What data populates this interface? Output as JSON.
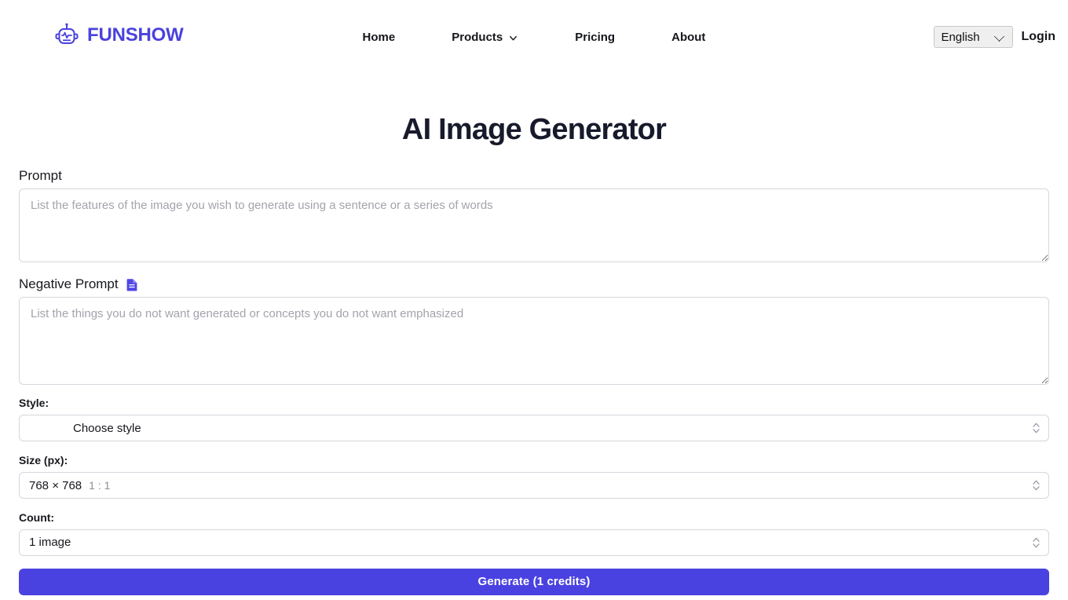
{
  "header": {
    "brand": {
      "name": "FUNSHOW",
      "icon": "robot-icon",
      "color": "#4a42dd"
    },
    "nav": [
      {
        "label": "Home",
        "has_chevron": false
      },
      {
        "label": "Products",
        "has_chevron": true
      },
      {
        "label": "Pricing",
        "has_chevron": false
      },
      {
        "label": "About",
        "has_chevron": false
      }
    ],
    "language": {
      "selected": "English",
      "options": [
        "English"
      ]
    },
    "login_label": "Login"
  },
  "page": {
    "title": "AI Image Generator"
  },
  "form": {
    "prompt": {
      "label": "Prompt",
      "value": "",
      "placeholder": "List the features of the image you wish to generate using a sentence or a series of words"
    },
    "negative_prompt": {
      "label": "Negative Prompt",
      "icon": "document-icon",
      "value": "",
      "placeholder": "List the things you do not want generated or concepts you do not want emphasized"
    },
    "style": {
      "label": "Style:",
      "value": "Choose style"
    },
    "size": {
      "label": "Size (px):",
      "value": "768 × 768",
      "ratio": "1 : 1"
    },
    "count": {
      "label": "Count:",
      "value": "1 image"
    },
    "generate": {
      "label": "Generate (1 credits)",
      "color": "#4a42e0"
    }
  }
}
